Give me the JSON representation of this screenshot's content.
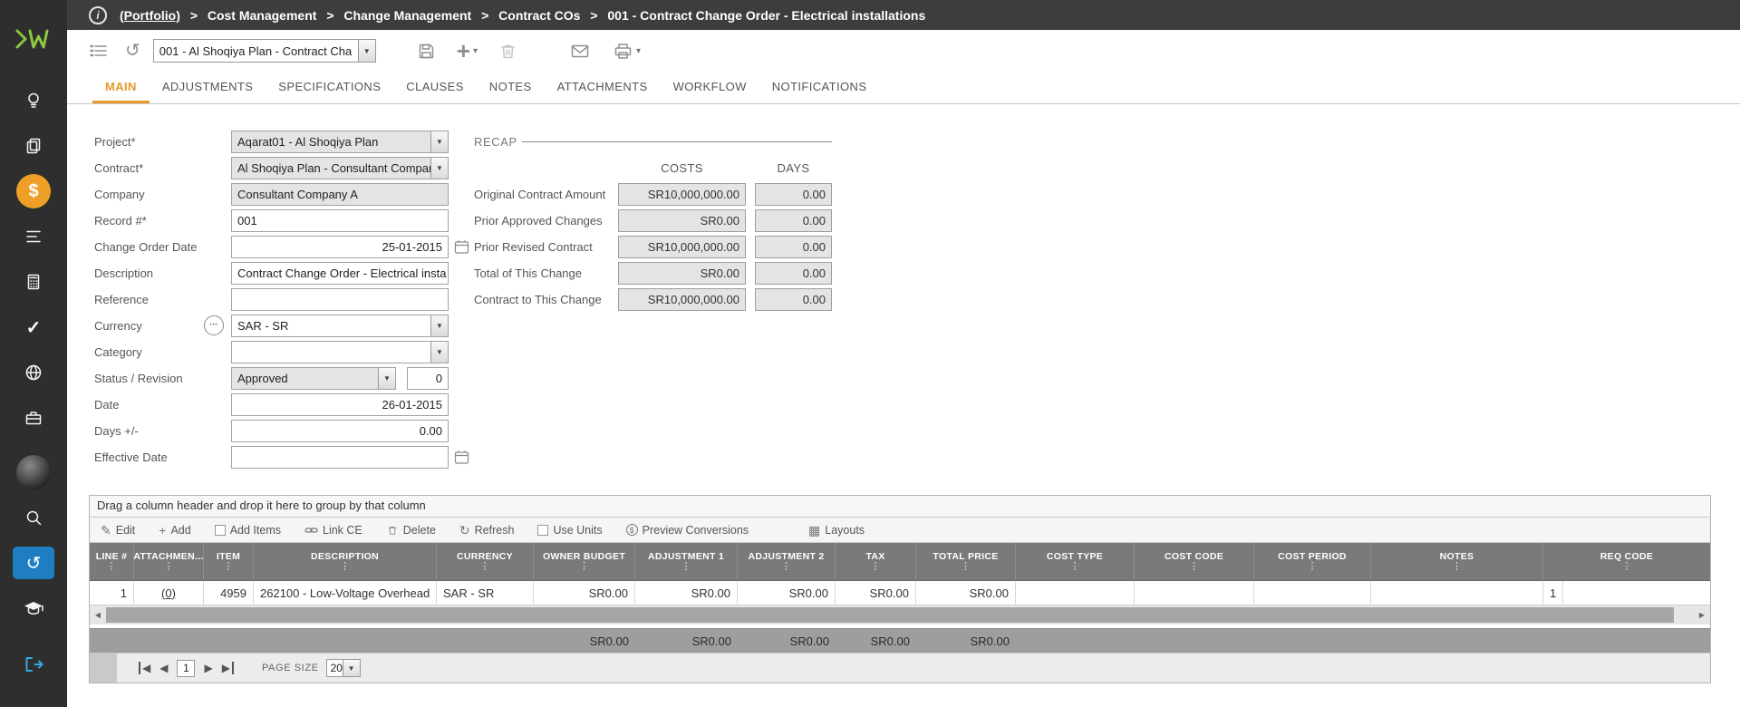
{
  "topbar": {
    "breadcrumb": {
      "root": "(Portfolio)",
      "separator": ">",
      "items": [
        "Cost Management",
        "Change Management",
        "Contract COs",
        "001 - Contract Change Order - Electrical installations"
      ]
    }
  },
  "toolbar": {
    "record_dropdown_value": "001 - Al Shoqiya Plan - Contract Cha"
  },
  "tabs": {
    "items": [
      {
        "label": "MAIN"
      },
      {
        "label": "ADJUSTMENTS"
      },
      {
        "label": "SPECIFICATIONS"
      },
      {
        "label": "CLAUSES"
      },
      {
        "label": "NOTES"
      },
      {
        "label": "ATTACHMENTS"
      },
      {
        "label": "WORKFLOW"
      },
      {
        "label": "NOTIFICATIONS"
      }
    ]
  },
  "form": {
    "project": {
      "label": "Project*",
      "value": "Aqarat01 - Al Shoqiya Plan"
    },
    "contract": {
      "label": "Contract*",
      "value": "Al Shoqiya Plan - Consultant Company A"
    },
    "company": {
      "label": "Company",
      "value": "Consultant Company A"
    },
    "record_no": {
      "label": "Record #*",
      "value": "001"
    },
    "change_order_date": {
      "label": "Change Order Date",
      "value": "25-01-2015"
    },
    "description": {
      "label": "Description",
      "value": "Contract Change Order - Electrical insta"
    },
    "reference": {
      "label": "Reference",
      "value": ""
    },
    "currency": {
      "label": "Currency",
      "value": "SAR - SR"
    },
    "category": {
      "label": "Category",
      "value": ""
    },
    "status_revision": {
      "label": "Status / Revision",
      "status": "Approved",
      "revision": "0"
    },
    "date": {
      "label": "Date",
      "value": "26-01-2015"
    },
    "days": {
      "label": "Days +/-",
      "value": "0.00"
    },
    "effective_date": {
      "label": "Effective Date",
      "value": ""
    }
  },
  "recap": {
    "title": "RECAP",
    "col_costs": "COSTS",
    "col_days": "DAYS",
    "rows": [
      {
        "label": "Original Contract Amount",
        "cost": "SR10,000,000.00",
        "days": "0.00"
      },
      {
        "label": "Prior Approved Changes",
        "cost": "SR0.00",
        "days": "0.00"
      },
      {
        "label": "Prior Revised Contract",
        "cost": "SR10,000,000.00",
        "days": "0.00"
      },
      {
        "label": "Total of This Change",
        "cost": "SR0.00",
        "days": "0.00"
      },
      {
        "label": "Contract to This Change",
        "cost": "SR10,000,000.00",
        "days": "0.00"
      }
    ]
  },
  "grid": {
    "group_hint": "Drag a column header and drop it here to group by that column",
    "toolbar": {
      "edit": "Edit",
      "add": "Add",
      "add_items": "Add Items",
      "link_ce": "Link CE",
      "delete": "Delete",
      "refresh": "Refresh",
      "use_units": "Use Units",
      "preview_conversions": "Preview Conversions",
      "layouts": "Layouts"
    },
    "columns": [
      "LINE #",
      "ATTACHMEN...",
      "ITEM",
      "DESCRIPTION",
      "CURRENCY",
      "OWNER BUDGET",
      "ADJUSTMENT 1",
      "ADJUSTMENT 2",
      "TAX",
      "TOTAL PRICE",
      "COST TYPE",
      "COST CODE",
      "COST PERIOD",
      "NOTES",
      "REQ CODE"
    ],
    "rows": [
      [
        "1",
        "(0)",
        "4959",
        "262100 - Low-Voltage Overhead",
        "SAR - SR",
        "SR0.00",
        "SR0.00",
        "SR0.00",
        "SR0.00",
        "SR0.00",
        "",
        "",
        "",
        "",
        "1"
      ]
    ],
    "totals": [
      "",
      "",
      "",
      "",
      "",
      "SR0.00",
      "SR0.00",
      "SR0.00",
      "SR0.00",
      "SR0.00",
      "",
      "",
      "",
      "",
      ""
    ],
    "pager": {
      "page": "1",
      "page_size_label": "PAGE SIZE",
      "page_size": "20"
    }
  },
  "icons": {
    "dropdown_arrow": "▼",
    "caret_down": "▾",
    "column_menu": "⋮",
    "check_mark": "✓",
    "history_arrow": "↺",
    "refresh_arrow": "↻",
    "pencil": "✎",
    "plus": "+",
    "dollar_sign": "$",
    "layouts_grid": "▦",
    "arrow_left": "◀",
    "arrow_right": "▶",
    "more_dots": "•••",
    "info_letter": "i"
  },
  "colors": {
    "topbar_bg": "#3d3d3d",
    "sidebar_bg": "#2e2e2e",
    "accent_orange": "#e8982c",
    "active_module_orange": "#ee9f27",
    "active_blue": "#1f7ec2",
    "logo_green": "#8dc63f",
    "grid_header_bg": "#7a7a7a",
    "grid_totals_bg": "#9e9e9e",
    "readonly_field_bg": "#e4e4e4"
  }
}
